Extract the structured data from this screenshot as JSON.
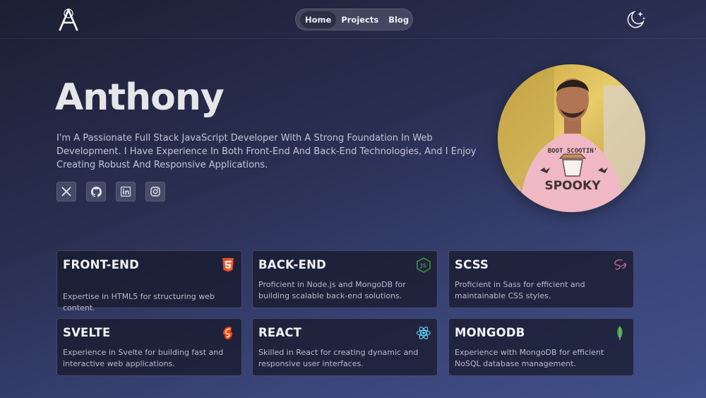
{
  "nav": {
    "items": [
      {
        "label": "Home",
        "active": true
      },
      {
        "label": "Projects",
        "active": false
      },
      {
        "label": "Blog",
        "active": false
      }
    ]
  },
  "theme_toggle": {
    "icon": "moon-stars-icon"
  },
  "hero": {
    "name": "Anthony",
    "description": "I'm A Passionate Full Stack JavaScript Developer With A Strong Foundation In Web Development. I Have Experience In Both Front-End And Back-End Technologies, And I Enjoy Creating Robust And Responsive Applications."
  },
  "socials": [
    {
      "icon": "x-twitter-icon"
    },
    {
      "icon": "github-icon"
    },
    {
      "icon": "linkedin-icon"
    },
    {
      "icon": "instagram-icon"
    }
  ],
  "skills": [
    {
      "title": "FRONT-END",
      "description": "Expertise in HTML5 for structuring web content.",
      "icon": "html5-icon",
      "color": "#e44d26"
    },
    {
      "title": "BACK-END",
      "description": "Proficient in Node.js and MongoDB for building scalable back-end solutions.",
      "icon": "nodejs-icon",
      "color": "#3c873a"
    },
    {
      "title": "SCSS",
      "description": "Proficient in Sass for efficient and maintainable CSS styles.",
      "icon": "sass-icon",
      "color": "#cd6799"
    },
    {
      "title": "SVELTE",
      "description": "Experience in Svelte for building fast and interactive web applications.",
      "icon": "svelte-icon",
      "color": "#ff3e00"
    },
    {
      "title": "REACT",
      "description": "Skilled in React for creating dynamic and responsive user interfaces.",
      "icon": "react-icon",
      "color": "#61dafb"
    },
    {
      "title": "MONGODB",
      "description": "Experience with MongoDB for efficient NoSQL database management.",
      "icon": "mongodb-leaf-icon",
      "color": "#47a248"
    }
  ]
}
